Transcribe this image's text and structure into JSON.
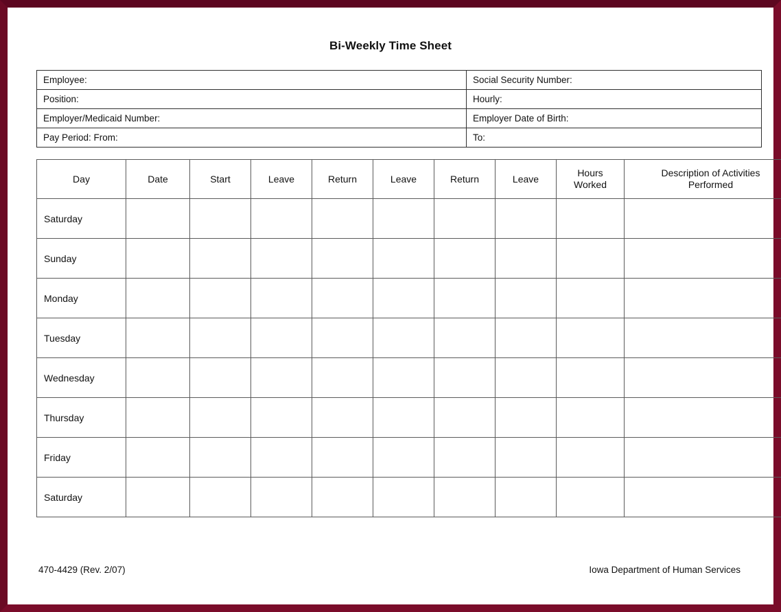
{
  "document": {
    "title": "Bi-Weekly Time Sheet"
  },
  "info_fields": [
    {
      "left_label": "Employee:",
      "right_label": "Social Security Number:"
    },
    {
      "left_label": "Position:",
      "right_label": "Hourly:"
    },
    {
      "left_label": "Employer/Medicaid Number:",
      "right_label": "Employer Date of Birth:"
    },
    {
      "left_label": "Pay Period:  From:",
      "right_label": "To:"
    }
  ],
  "timesheet": {
    "headers": [
      {
        "line1": "Day",
        "line2": ""
      },
      {
        "line1": "Date",
        "line2": ""
      },
      {
        "line1": "Start",
        "line2": ""
      },
      {
        "line1": "Leave",
        "line2": ""
      },
      {
        "line1": "Return",
        "line2": ""
      },
      {
        "line1": "Leave",
        "line2": ""
      },
      {
        "line1": "Return",
        "line2": ""
      },
      {
        "line1": "Leave",
        "line2": ""
      },
      {
        "line1": "Hours",
        "line2": "Worked"
      },
      {
        "line1": "Description of Activities",
        "line2": "Performed"
      }
    ],
    "rows": [
      {
        "day": "Saturday",
        "date": "",
        "start": "",
        "leave1": "",
        "return1": "",
        "leave2": "",
        "return2": "",
        "leave3": "",
        "hours_worked": "",
        "description": ""
      },
      {
        "day": "Sunday",
        "date": "",
        "start": "",
        "leave1": "",
        "return1": "",
        "leave2": "",
        "return2": "",
        "leave3": "",
        "hours_worked": "",
        "description": ""
      },
      {
        "day": "Monday",
        "date": "",
        "start": "",
        "leave1": "",
        "return1": "",
        "leave2": "",
        "return2": "",
        "leave3": "",
        "hours_worked": "",
        "description": ""
      },
      {
        "day": "Tuesday",
        "date": "",
        "start": "",
        "leave1": "",
        "return1": "",
        "leave2": "",
        "return2": "",
        "leave3": "",
        "hours_worked": "",
        "description": ""
      },
      {
        "day": "Wednesday",
        "date": "",
        "start": "",
        "leave1": "",
        "return1": "",
        "leave2": "",
        "return2": "",
        "leave3": "",
        "hours_worked": "",
        "description": ""
      },
      {
        "day": "Thursday",
        "date": "",
        "start": "",
        "leave1": "",
        "return1": "",
        "leave2": "",
        "return2": "",
        "leave3": "",
        "hours_worked": "",
        "description": ""
      },
      {
        "day": "Friday",
        "date": "",
        "start": "",
        "leave1": "",
        "return1": "",
        "leave2": "",
        "return2": "",
        "leave3": "",
        "hours_worked": "",
        "description": ""
      },
      {
        "day": "Saturday",
        "date": "",
        "start": "",
        "leave1": "",
        "return1": "",
        "leave2": "",
        "return2": "",
        "leave3": "",
        "hours_worked": "",
        "description": ""
      }
    ]
  },
  "footer": {
    "form_number": "470-4429  (Rev. 2/07)",
    "agency": "Iowa Department of Human Services"
  },
  "colors": {
    "border_frame": "#6e0a25",
    "page_background": "#ffffff",
    "grid_line": "#5a5a5a",
    "text": "#111111"
  }
}
